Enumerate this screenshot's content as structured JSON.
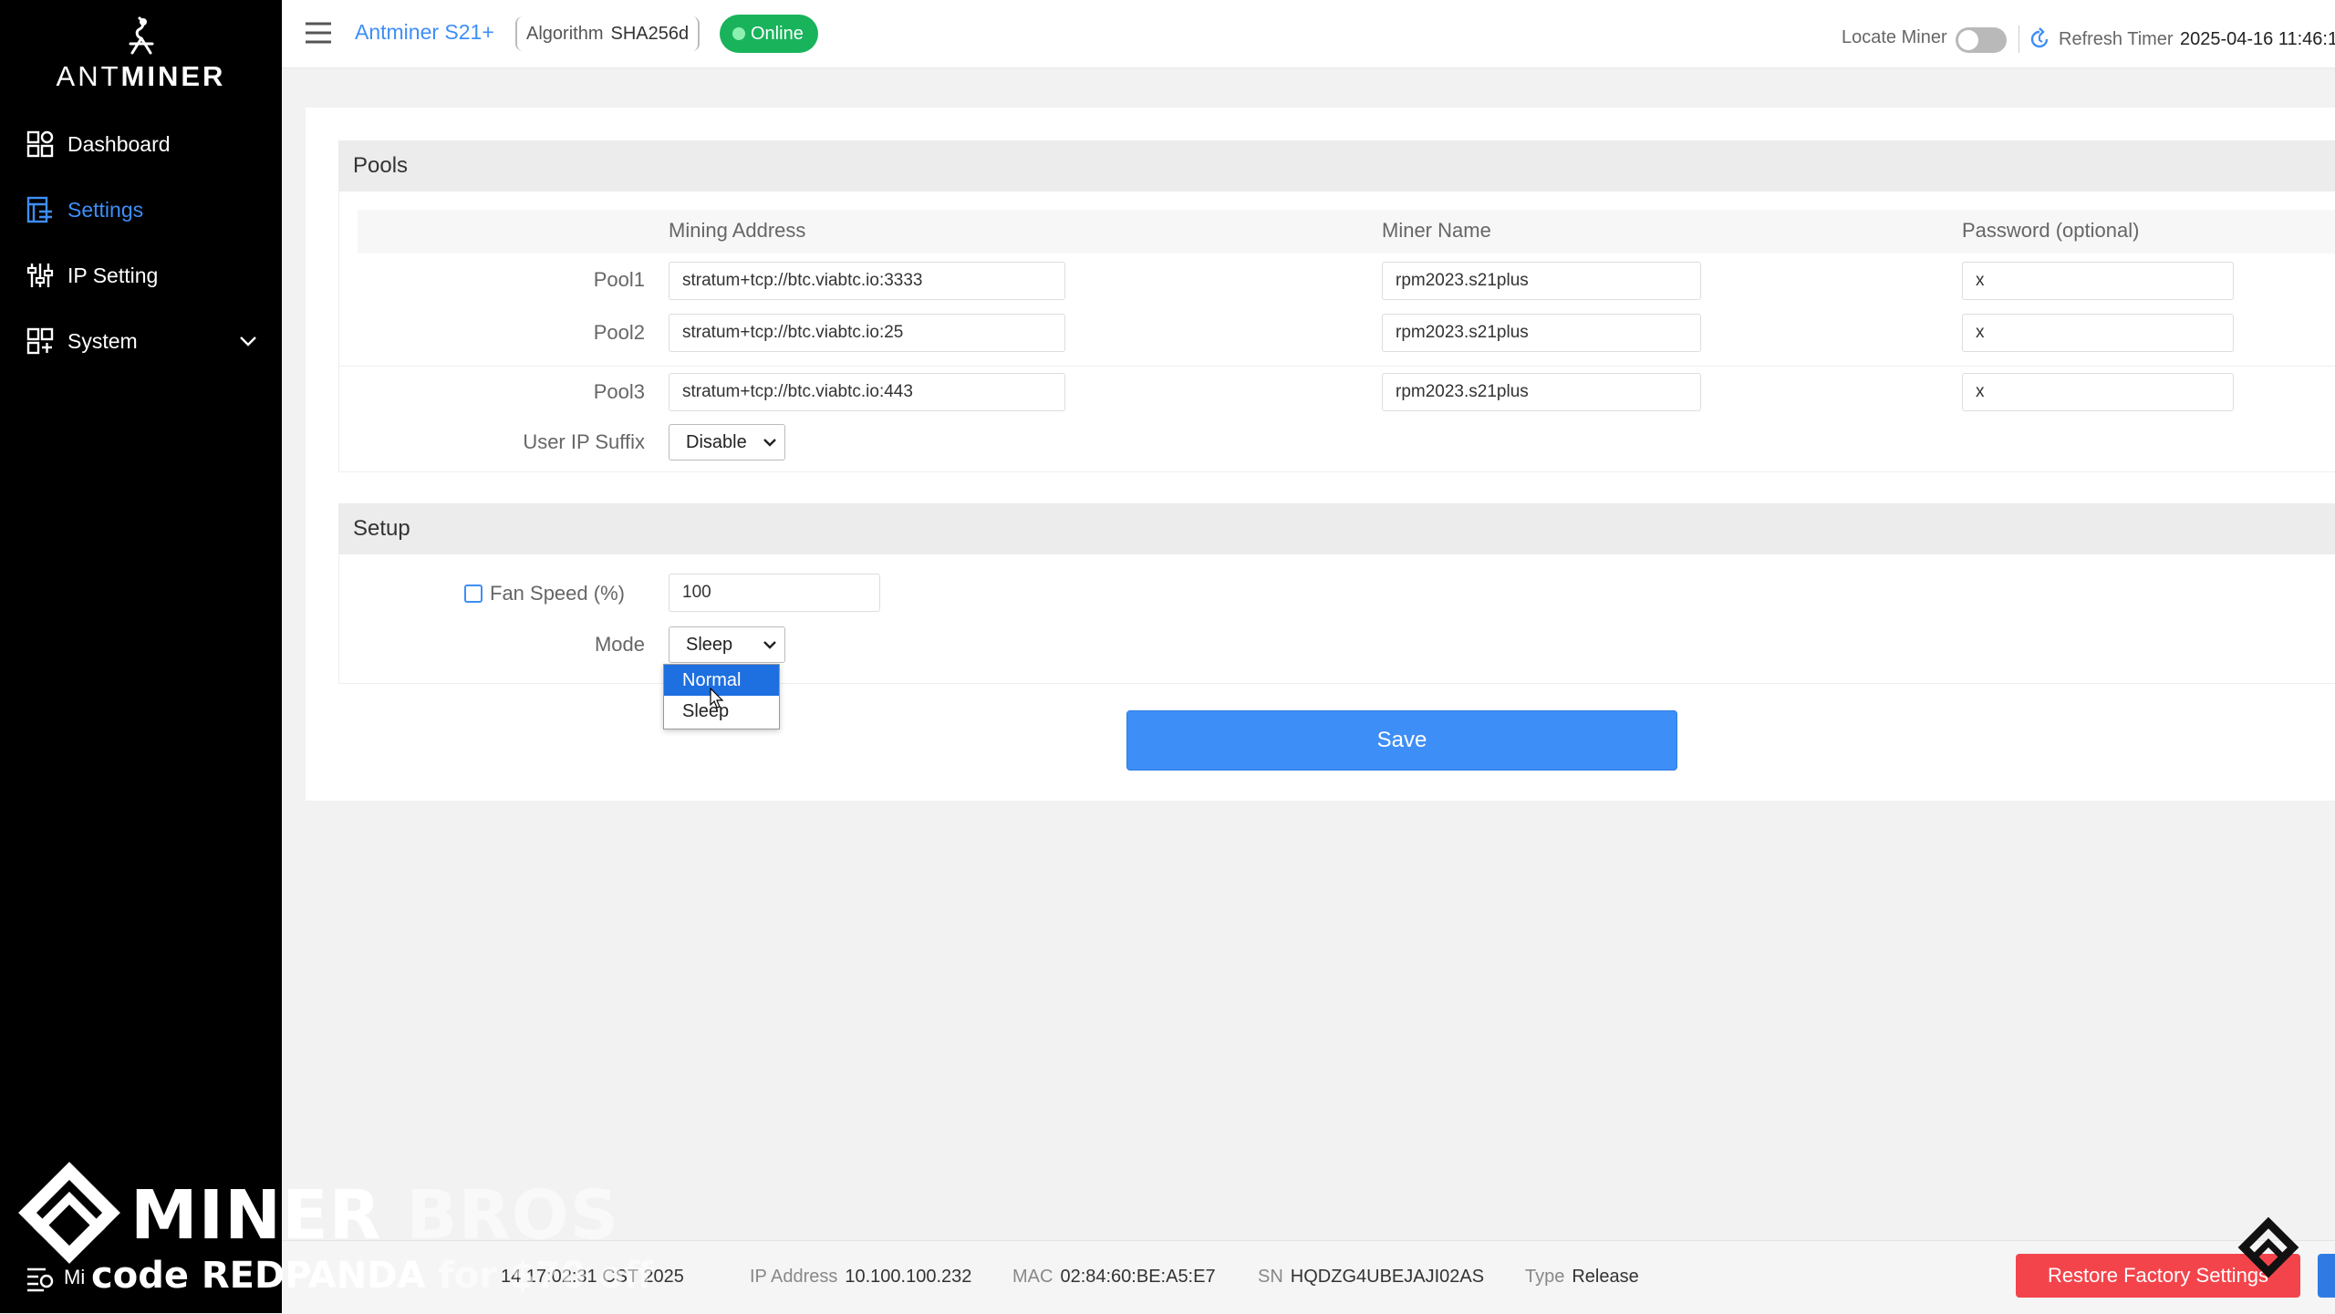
{
  "brand": {
    "prefix": "ANT",
    "suffix": "MINER"
  },
  "sidebar": {
    "items": [
      {
        "label": "Dashboard",
        "icon": "dashboard-icon",
        "active": false
      },
      {
        "label": "Settings",
        "icon": "settings-icon",
        "active": true
      },
      {
        "label": "IP Setting",
        "icon": "ip-setting-icon",
        "active": false
      },
      {
        "label": "System",
        "icon": "system-icon",
        "active": false
      }
    ],
    "footer_label": "Mi"
  },
  "header": {
    "model": "Antminer S21+",
    "algorithm_label": "Algorithm",
    "algorithm_value": "SHA256d",
    "status": "Online",
    "locate_label": "Locate Miner",
    "refresh_label": "Refresh Timer",
    "refresh_time": "2025-04-16 11:46:1"
  },
  "pools": {
    "title": "Pools",
    "columns": [
      "Mining Address",
      "Miner Name",
      "Password (optional)"
    ],
    "rows": [
      {
        "label": "Pool1",
        "address": "stratum+tcp://btc.viabtc.io:3333",
        "name": "rpm2023.s21plus",
        "password": "x"
      },
      {
        "label": "Pool2",
        "address": "stratum+tcp://btc.viabtc.io:25",
        "name": "rpm2023.s21plus",
        "password": "x"
      },
      {
        "label": "Pool3",
        "address": "stratum+tcp://btc.viabtc.io:443",
        "name": "rpm2023.s21plus",
        "password": "x"
      }
    ],
    "suffix_label": "User IP Suffix",
    "suffix_value": "Disable"
  },
  "setup": {
    "title": "Setup",
    "fan_label": "Fan Speed (%)",
    "fan_value": "100",
    "mode_label": "Mode",
    "mode_value": "Sleep",
    "mode_options": [
      "Normal",
      "Sleep"
    ]
  },
  "save_label": "Save",
  "footer": {
    "time_fragment": "14 17:02:31 CST 2025",
    "ip_label": "IP Address",
    "ip_value": "10.100.100.232",
    "mac_label": "MAC",
    "mac_value": "02:84:60:BE:A5:E7",
    "sn_label": "SN",
    "sn_value": "HQDZG4UBEJAJI02AS",
    "type_label": "Type",
    "type_value": "Release",
    "restore_label": "Restore Factory Settings"
  },
  "watermark": {
    "title_a": "MINER",
    "title_b": "BROS",
    "code_a": "code REDPANDA",
    "code_b": "for $70 off"
  },
  "colors": {
    "accent": "#3e8ef7",
    "online": "#19b35c",
    "danger": "#f4444b",
    "sidebar": "#000000"
  }
}
